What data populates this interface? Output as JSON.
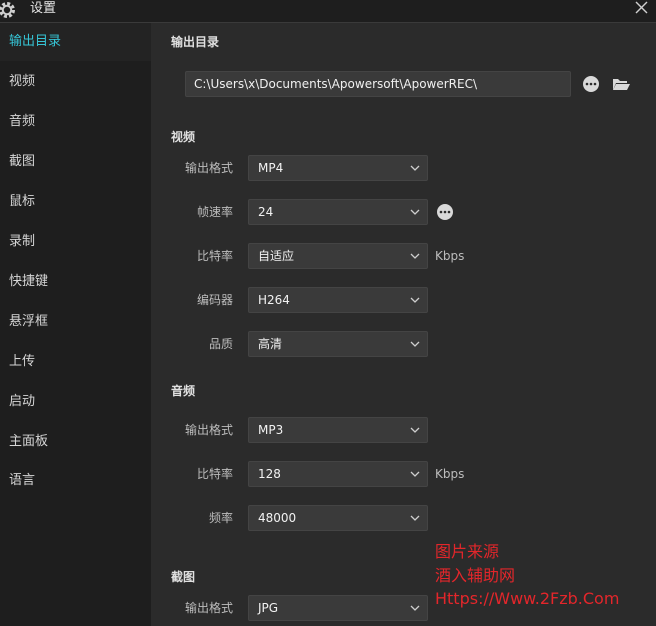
{
  "window": {
    "title": "设置"
  },
  "sidebar": {
    "items": [
      {
        "label": "输出目录",
        "active": true
      },
      {
        "label": "视频"
      },
      {
        "label": "音频"
      },
      {
        "label": "截图"
      },
      {
        "label": "鼠标"
      },
      {
        "label": "录制"
      },
      {
        "label": "快捷键"
      },
      {
        "label": "悬浮框"
      },
      {
        "label": "上传"
      },
      {
        "label": "启动"
      },
      {
        "label": "主面板"
      },
      {
        "label": "语言"
      }
    ]
  },
  "output": {
    "section_title": "输出目录",
    "path": "C:\\Users\\x\\Documents\\Apowersoft\\ApowerREC\\"
  },
  "video": {
    "section_title": "视频",
    "format_label": "输出格式",
    "format_value": "MP4",
    "fps_label": "帧速率",
    "fps_value": "24",
    "bitrate_label": "比特率",
    "bitrate_value": "自适应",
    "bitrate_unit": "Kbps",
    "encoder_label": "编码器",
    "encoder_value": "H264",
    "quality_label": "品质",
    "quality_value": "高清"
  },
  "audio": {
    "section_title": "音频",
    "format_label": "输出格式",
    "format_value": "MP3",
    "bitrate_label": "比特率",
    "bitrate_value": "128",
    "bitrate_unit": "Kbps",
    "freq_label": "频率",
    "freq_value": "48000"
  },
  "screenshot": {
    "section_title": "截图",
    "format_label": "输出格式",
    "format_value": "JPG"
  },
  "watermark": {
    "line1": "图片来源",
    "line2": "酒入辅助网",
    "line3": "Https://Www.2Fzb.Com"
  },
  "colors": {
    "accent": "#36c5d6",
    "watermark": "#e3262b",
    "sidebar_bg": "#1e1e1e",
    "main_bg": "#2b2b2b",
    "field_bg": "#3a3a3a"
  }
}
